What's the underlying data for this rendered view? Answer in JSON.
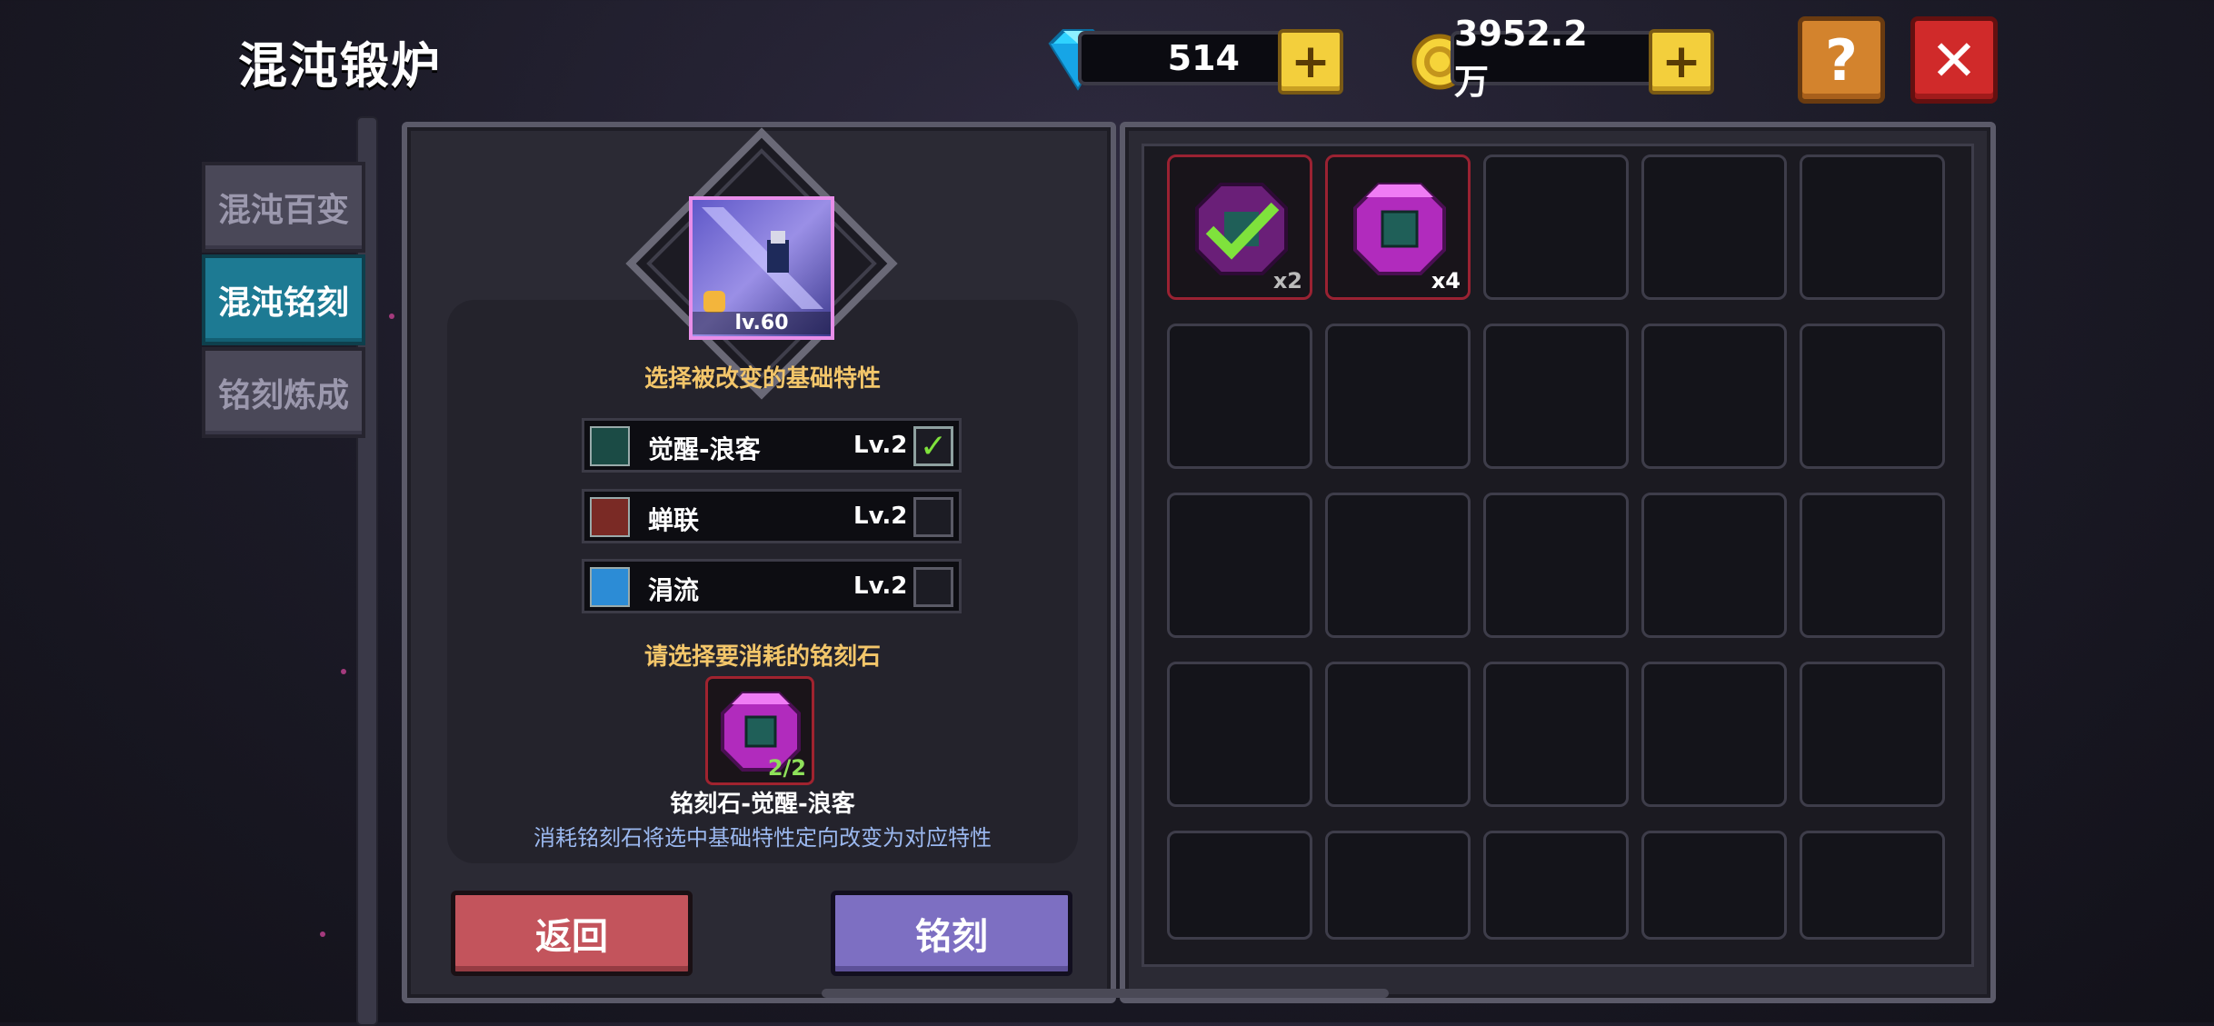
{
  "header": {
    "title": "混沌锻炉"
  },
  "resources": {
    "gems": {
      "value": "514",
      "plus": "+"
    },
    "gold": {
      "value": "3952.2万",
      "plus": "+"
    }
  },
  "top_buttons": {
    "help": "?",
    "close": "✕"
  },
  "sidebar": {
    "tabs": [
      {
        "label": "混沌百变",
        "active": false
      },
      {
        "label": "混沌铭刻",
        "active": true
      },
      {
        "label": "铭刻炼成",
        "active": false
      }
    ]
  },
  "left_panel": {
    "weapon_level": "lv.60",
    "select_traits_title": "选择被改变的基础特性",
    "traits": [
      {
        "name": "觉醒-浪客",
        "level": "Lv.2",
        "selected": true,
        "check": "✓"
      },
      {
        "name": "蝉联",
        "level": "Lv.2",
        "selected": false,
        "check": ""
      },
      {
        "name": "涓流",
        "level": "Lv.2",
        "selected": false,
        "check": ""
      }
    ],
    "consume_title": "请选择要消耗的铭刻石",
    "selected_stone": {
      "count": "2/2",
      "name": "铭刻石-觉醒-浪客"
    },
    "description": "消耗铭刻石将选中基础特性定向改变为对应特性",
    "buttons": {
      "back": "返回",
      "engrave": "铭刻"
    }
  },
  "inventory": {
    "slots": [
      {
        "filled": true,
        "count": "x2",
        "checked": true
      },
      {
        "filled": true,
        "count": "x4",
        "checked": false
      }
    ],
    "total_slots": 25
  },
  "colors": {
    "accent_teal": "#1d7a93",
    "back_red": "#c3545c",
    "engrave_purple": "#7d6fc2",
    "gold": "#f3cf3c",
    "check_green": "#7fe23c"
  }
}
